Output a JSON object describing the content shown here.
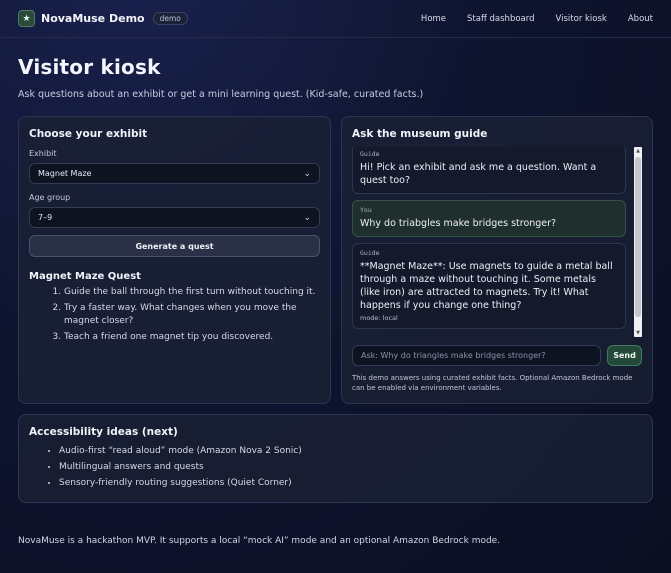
{
  "nav": {
    "logo_glyph": "★",
    "brand": "NovaMuse Demo",
    "badge": "demo",
    "links": [
      "Home",
      "Staff dashboard",
      "Visitor kiosk",
      "About"
    ]
  },
  "hero": {
    "title": "Visitor kiosk",
    "subtitle": "Ask questions about an exhibit or get a mini learning quest. (Kid-safe, curated facts.)"
  },
  "exhibit_panel": {
    "title": "Choose your exhibit",
    "exhibit_label": "Exhibit",
    "exhibit_value": "Magnet Maze",
    "age_label": "Age group",
    "age_value": "7–9",
    "generate_label": "Generate a quest",
    "quest_title": "Magnet Maze Quest",
    "quest_steps": [
      "Guide the ball through the first turn without touching it.",
      "Try a faster way. What changes when you move the magnet closer?",
      "Teach a friend one magnet tip you discovered."
    ]
  },
  "guide_panel": {
    "title": "Ask the museum guide",
    "messages": [
      {
        "who": "Guide",
        "text": "Hi! Pick an exhibit and ask me a question. Want a quest too?",
        "mode": ""
      },
      {
        "who": "You",
        "text": "Why do triabgles make bridges stronger?",
        "mode": ""
      },
      {
        "who": "Guide",
        "text": "**Magnet Maze**: Use magnets to guide a metal ball through a maze without touching it. Some metals (like iron) are attracted to magnets. Try it! What happens if you change one thing?",
        "mode": "mode: local"
      }
    ],
    "input_placeholder": "Ask: Why do triangles make bridges stronger?",
    "send_label": "Send",
    "note": "This demo answers using curated exhibit facts. Optional Amazon Bedrock mode can be enabled via environment variables."
  },
  "accessibility": {
    "title": "Accessibility ideas (next)",
    "items": [
      "Audio-first “read aloud” mode (Amazon Nova 2 Sonic)",
      "Multilingual answers and quests",
      "Sensory-friendly routing suggestions (Quiet Corner)"
    ]
  },
  "footer": {
    "text": "NovaMuse is a hackathon MVP. It supports a local “mock AI” mode and an optional Amazon Bedrock mode."
  },
  "colors": {
    "send_bg": "#24493a",
    "you_bubble_bg": "#1f2f2c"
  }
}
